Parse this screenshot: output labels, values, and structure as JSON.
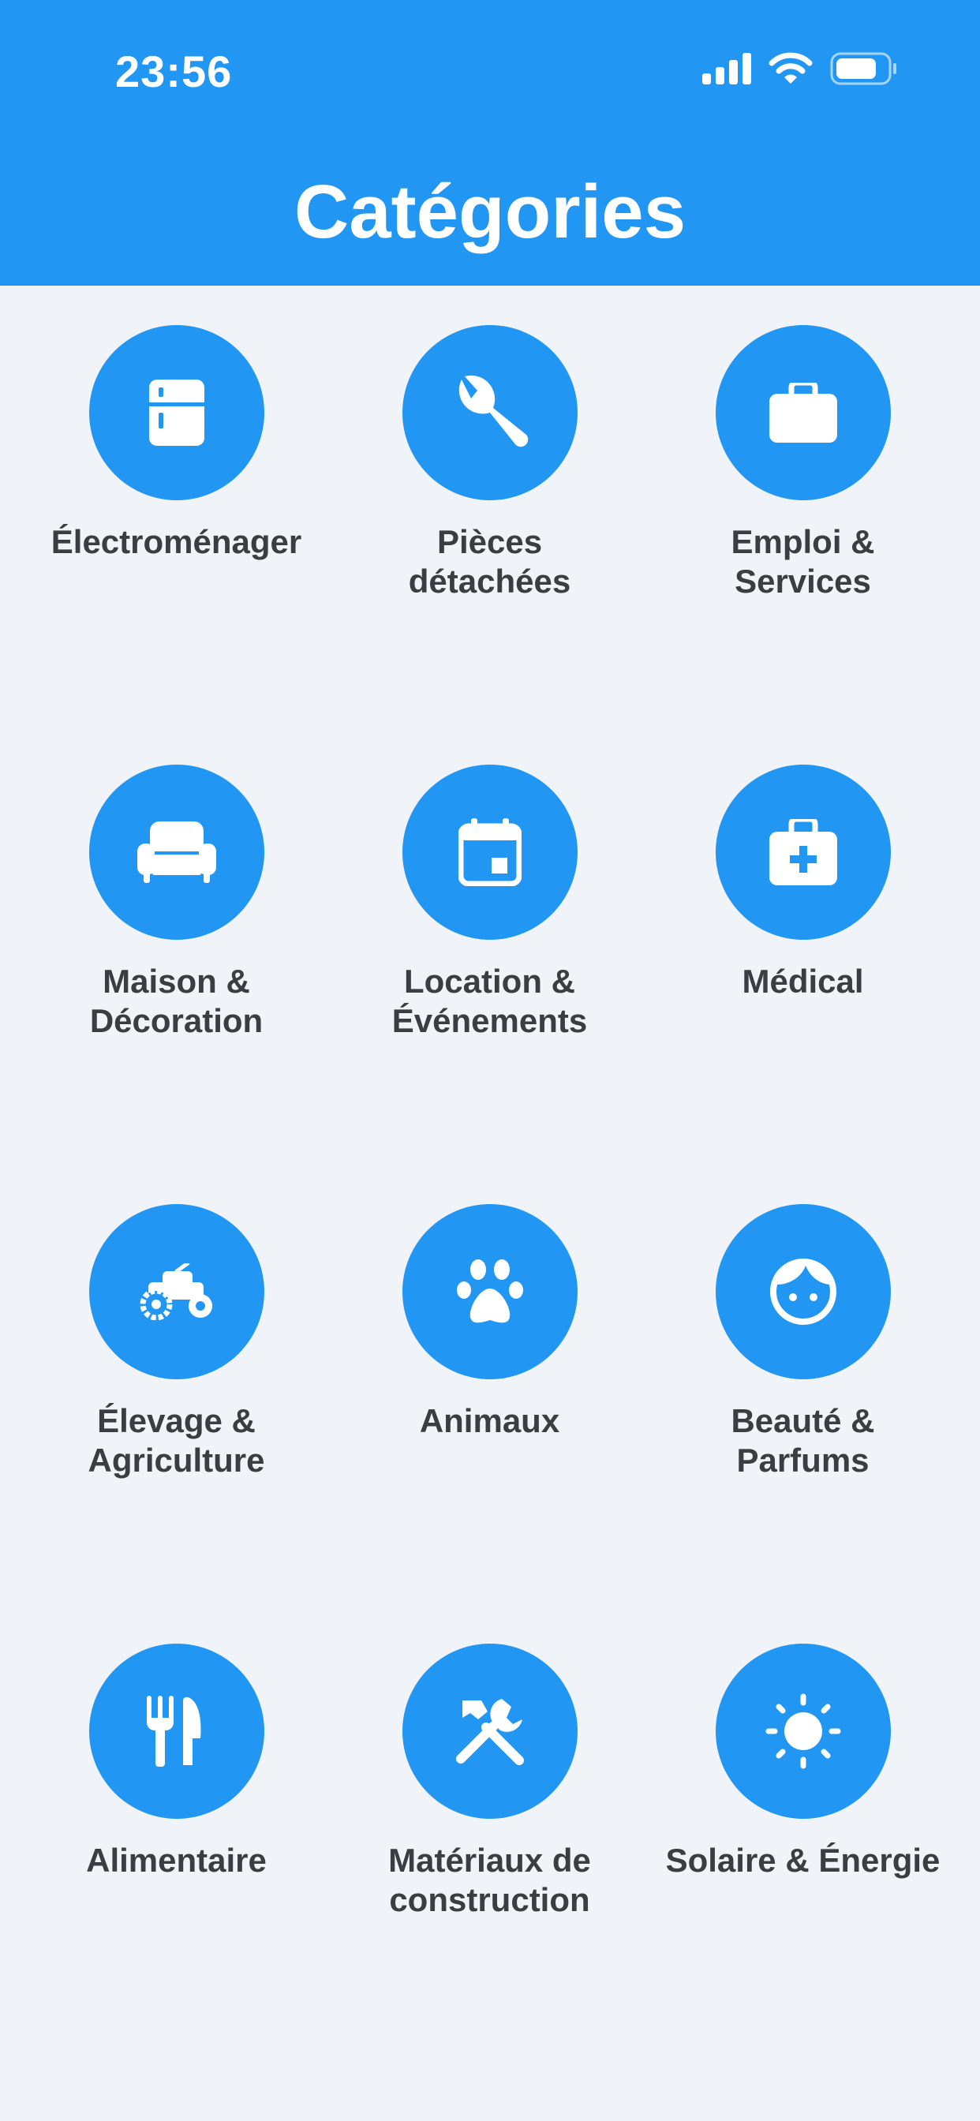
{
  "status_bar": {
    "time": "23:56",
    "icons": [
      "signal-icon",
      "wifi-icon",
      "battery-icon"
    ]
  },
  "header": {
    "title": "Catégories",
    "background_color": "#2196f3"
  },
  "colors": {
    "accent": "#2196f3",
    "background": "#f0f4f9",
    "label_text": "#3b3d42"
  },
  "categories": [
    {
      "label": "Électroménager",
      "icon": "refrigerator-icon"
    },
    {
      "label": "Pièces\ndétachées",
      "icon": "wrench-icon"
    },
    {
      "label": "Emploi &\nServices",
      "icon": "briefcase-icon"
    },
    {
      "label": "Maison &\nDécoration",
      "icon": "sofa-icon"
    },
    {
      "label": "Location &\nÉvénements",
      "icon": "calendar-icon"
    },
    {
      "label": "Médical",
      "icon": "medical-kit-icon"
    },
    {
      "label": "Élevage &\nAgriculture",
      "icon": "tractor-icon"
    },
    {
      "label": "Animaux",
      "icon": "paw-icon"
    },
    {
      "label": "Beauté &\nParfums",
      "icon": "face-icon"
    },
    {
      "label": "Alimentaire",
      "icon": "fork-knife-icon"
    },
    {
      "label": "Matériaux de\nconstruction",
      "icon": "tools-icon"
    },
    {
      "label": "Solaire & Énergie",
      "icon": "sun-icon"
    }
  ]
}
